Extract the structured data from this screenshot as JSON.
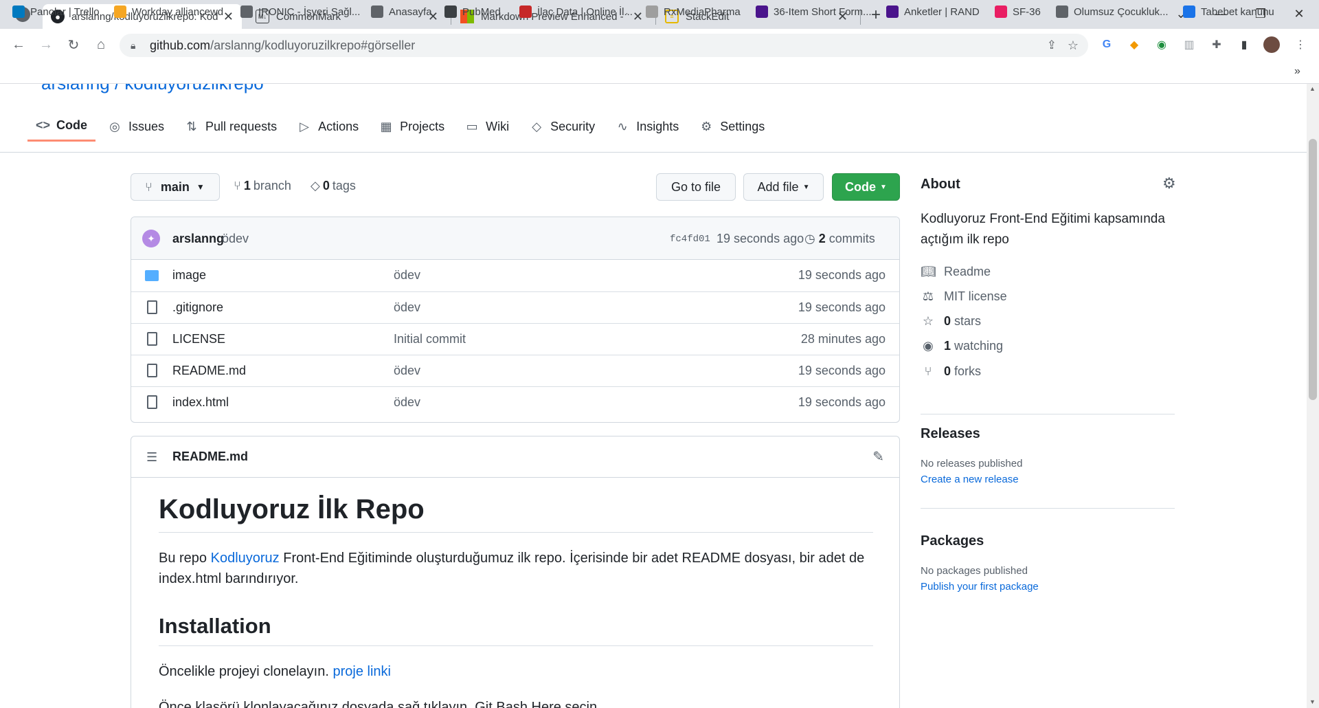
{
  "browser": {
    "tabs": [
      {
        "title": "arslanng/kodluyoruzilkrepo: Kodl",
        "active": true,
        "icon": "github-icon"
      },
      {
        "title": "CommonMark",
        "active": false,
        "icon": "markdown-icon"
      },
      {
        "title": "Markdown Preview Enhanced - V",
        "active": false,
        "icon": "microsoft-icon"
      },
      {
        "title": "StackEdit",
        "active": false,
        "icon": "stackedit-icon"
      }
    ],
    "url_host": "github.com",
    "url_path": "/arslanng/kodluyoruzilkrepo#görseller",
    "bookmarks": [
      {
        "label": "Panolar | Trello",
        "color": "#0079bf"
      },
      {
        "label": "Workday alliancewd",
        "color": "#f5a623"
      },
      {
        "label": "IRONIC - İşyeri Sağl...",
        "color": "#5f6368"
      },
      {
        "label": "Anasayfa",
        "color": "#5f6368"
      },
      {
        "label": "PubMed",
        "color": "#3c4043"
      },
      {
        "label": "İlaç Data | Online İl...",
        "color": "#c62828"
      },
      {
        "label": "RxMediaPharma",
        "color": "#9e9e9e"
      },
      {
        "label": "36-Item Short Form...",
        "color": "#4a148c"
      },
      {
        "label": "Anketler | RAND",
        "color": "#4a148c"
      },
      {
        "label": "SF-36",
        "color": "#e91e63"
      },
      {
        "label": "Olumsuz Çocukluk...",
        "color": "#5f6368"
      },
      {
        "label": "Tabebet kanunu",
        "color": "#1a73e8"
      }
    ]
  },
  "repo": {
    "cut_title": "arslanng / kodluyoruzilkrepo",
    "tabs": [
      {
        "label": "Code",
        "icon": "<>",
        "active": true
      },
      {
        "label": "Issues",
        "icon": "◎"
      },
      {
        "label": "Pull requests",
        "icon": "⇅"
      },
      {
        "label": "Actions",
        "icon": "▷"
      },
      {
        "label": "Projects",
        "icon": "▦"
      },
      {
        "label": "Wiki",
        "icon": "▭"
      },
      {
        "label": "Security",
        "icon": "◇"
      },
      {
        "label": "Insights",
        "icon": "∿"
      },
      {
        "label": "Settings",
        "icon": "⚙"
      }
    ],
    "branch": "main",
    "branch_count": "1",
    "branch_label": "branch",
    "tag_count": "0",
    "tag_label": "tags",
    "go_to_file": "Go to file",
    "add_file": "Add file",
    "code_button": "Code",
    "commit": {
      "author": "arslanng",
      "message": "ödev",
      "sha": "fc4fd01",
      "time": "19 seconds ago",
      "commits_count": "2",
      "commits_label": "commits"
    },
    "files": [
      {
        "name": "image",
        "type": "folder",
        "message": "ödev",
        "time": "19 seconds ago"
      },
      {
        "name": ".gitignore",
        "type": "file",
        "message": "ödev",
        "time": "19 seconds ago"
      },
      {
        "name": "LICENSE",
        "type": "file",
        "message": "Initial commit",
        "time": "28 minutes ago"
      },
      {
        "name": "README.md",
        "type": "file",
        "message": "ödev",
        "time": "19 seconds ago"
      },
      {
        "name": "index.html",
        "type": "file",
        "message": "ödev",
        "time": "19 seconds ago"
      }
    ],
    "readme": {
      "filename": "README.md",
      "h1": "Kodluyoruz İlk Repo",
      "p1_before": "Bu repo ",
      "p1_link": "Kodluyoruz",
      "p1_after": " Front-End Eğitiminde oluşturduğumuz ilk repo. İçerisinde bir adet README dosyası, bir adet de index.html barındırıyor.",
      "h2": "Installation",
      "p2_before": "Öncelikle projeyi clonelayın. ",
      "p2_link": "proje linki",
      "p3": "Önce klasörü klonlayacağınız dosyada sağ tıklayın, Git Bash Here seçin"
    },
    "about": {
      "heading": "About",
      "description": "Kodluyoruz Front-End Eğitimi kapsamında açtığım ilk repo",
      "readme": "Readme",
      "license": "MIT license",
      "stars_count": "0",
      "stars_label": "stars",
      "watching_count": "1",
      "watching_label": "watching",
      "forks_count": "0",
      "forks_label": "forks"
    },
    "releases": {
      "heading": "Releases",
      "text": "No releases published",
      "link": "Create a new release"
    },
    "packages": {
      "heading": "Packages",
      "text": "No packages published",
      "link": "Publish your first package"
    }
  }
}
